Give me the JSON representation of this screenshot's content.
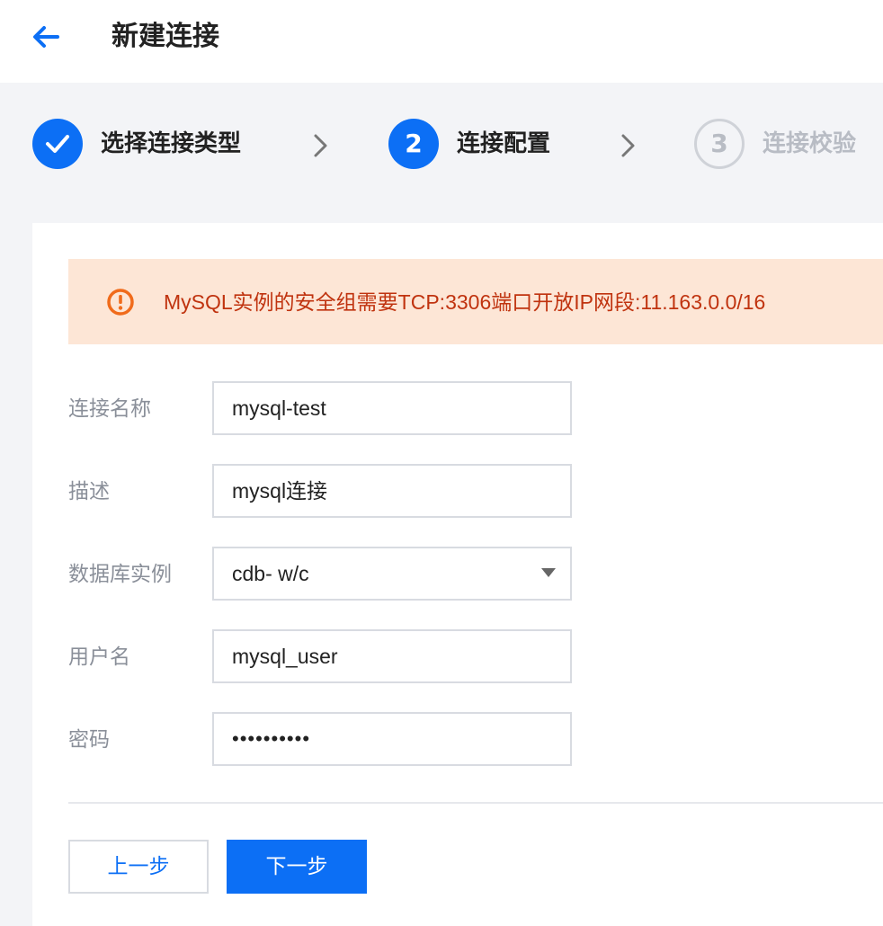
{
  "header": {
    "title": "新建连接",
    "back_icon": "arrow-left-icon"
  },
  "steps": [
    {
      "label": "选择连接类型",
      "status": "done",
      "marker": ""
    },
    {
      "label": "连接配置",
      "status": "active",
      "marker": "2"
    },
    {
      "label": "连接校验",
      "status": "todo",
      "marker": "3"
    }
  ],
  "alert": {
    "icon": "warning-icon",
    "text": "MySQL实例的安全组需要TCP:3306端口开放IP网段:11.163.0.0/16"
  },
  "form": {
    "name_label": "连接名称",
    "name_value": "mysql-test",
    "desc_label": "描述",
    "desc_value": "mysql连接",
    "instance_label": "数据库实例",
    "instance_value": "cdb-           w/c",
    "username_label": "用户名",
    "username_value": "mysql_user",
    "password_label": "密码",
    "password_value": "••••••••••"
  },
  "buttons": {
    "prev": "上一步",
    "next": "下一步"
  },
  "colors": {
    "primary": "#0c6ff5",
    "alert_bg": "#fde6d6",
    "alert_text": "#c0330f",
    "alert_icon": "#f06b1b"
  }
}
